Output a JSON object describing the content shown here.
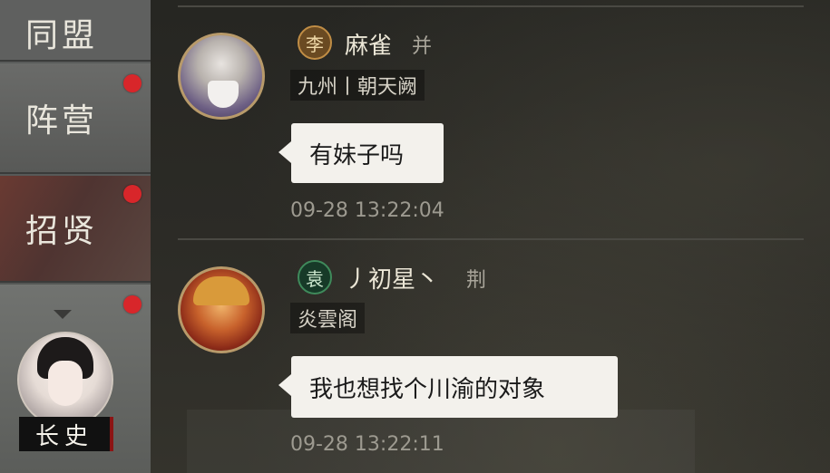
{
  "sidebar": {
    "items": [
      {
        "label": "同盟",
        "has_notification": false
      },
      {
        "label": "阵营",
        "has_notification": true
      },
      {
        "label": "招贤",
        "has_notification": true
      }
    ],
    "profile": {
      "rank_label": "长史",
      "has_notification": true
    }
  },
  "messages": [
    {
      "faction_char": "李",
      "username": "麻雀",
      "region": "并",
      "guild": "九州丨朝天阙",
      "text": "有妹子吗",
      "timestamp": "09-28 13:22:04"
    },
    {
      "faction_char": "袁",
      "username": "丿初星丶",
      "region": "荆",
      "guild": "炎雲阁",
      "text": "我也想找个川渝的对象",
      "timestamp": "09-28 13:22:11"
    }
  ],
  "colors": {
    "notification_dot": "#d8262a",
    "faction_1": "#c08d45",
    "faction_2": "#3f8a5b",
    "bubble": "#f3f1ec"
  }
}
